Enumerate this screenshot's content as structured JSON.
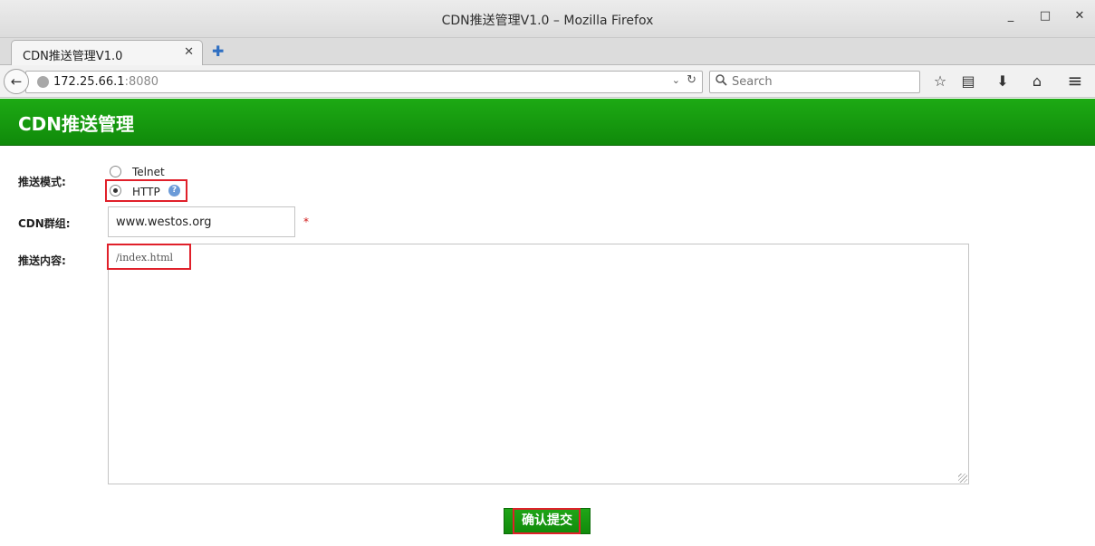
{
  "window": {
    "title": "CDN推送管理V1.0 – Mozilla Firefox",
    "controls": {
      "minimize": "_",
      "maximize": "□",
      "close": "✕"
    }
  },
  "tabs": [
    {
      "label": "CDN推送管理V1.0",
      "close": "✕"
    }
  ],
  "new_tab": "✚",
  "navbar": {
    "back": "←",
    "url_host": "172.25.66.1",
    "url_port": ":8080",
    "url_dropdown": "⌄",
    "reload": "↻",
    "search_placeholder": "Search",
    "icons": [
      "bookmark-star-icon",
      "reading-list-icon",
      "downloads-icon",
      "home-icon",
      "menu-icon"
    ],
    "icon_glyphs": {
      "star": "☆",
      "list": "▤",
      "download": "⬇",
      "home": "⌂",
      "menu": "≡"
    }
  },
  "page": {
    "header_title": "CDN推送管理",
    "form": {
      "mode_label": "推送模式:",
      "mode_options": [
        {
          "label": "Telnet",
          "checked": false
        },
        {
          "label": "HTTP",
          "checked": true
        }
      ],
      "help_glyph": "?",
      "group_label": "CDN群组:",
      "group_value": "www.westos.org",
      "required_mark": "*",
      "content_label": "推送内容:",
      "content_value": "/index.html",
      "submit_label": "确认提交"
    }
  },
  "colors": {
    "header_green": "#15a00e",
    "highlight_red": "#e0202a",
    "required_red": "#d01818"
  }
}
